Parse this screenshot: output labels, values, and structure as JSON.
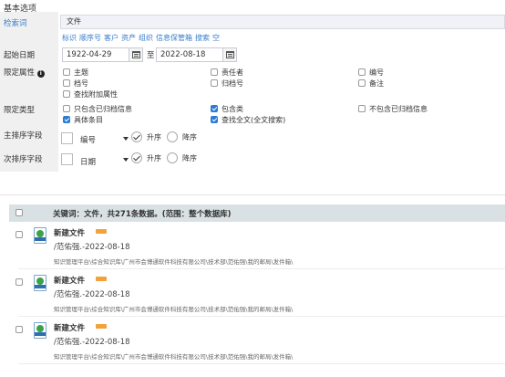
{
  "section_title": "基本选项",
  "labels": {
    "keyword": "检索词",
    "date": "起始日期",
    "attr": "限定属性",
    "type": "限定类型",
    "primary_sort": "主排序字段",
    "secondary_sort": "次排序字段"
  },
  "keyword_value": "文件",
  "keyword_links": [
    "标识",
    "顺序号",
    "客户",
    "资产",
    "组织",
    "信息保管箱",
    "搜索",
    "空"
  ],
  "date_from": "1922-04-29",
  "date_sep": "至",
  "date_to": "2022-08-18",
  "attr_options": [
    {
      "label": "主题",
      "checked": false
    },
    {
      "label": "责任者",
      "checked": false
    },
    {
      "label": "编号",
      "checked": false
    },
    {
      "label": "档号",
      "checked": false
    },
    {
      "label": "归档号",
      "checked": false
    },
    {
      "label": "备注",
      "checked": false
    },
    {
      "label": "查找附加属性",
      "checked": false
    }
  ],
  "type_options": [
    {
      "label": "只包含已归档信息",
      "checked": false
    },
    {
      "label": "包含类",
      "checked": true
    },
    {
      "label": "不包含已归档信息",
      "checked": false
    },
    {
      "label": "具体条目",
      "checked": true
    },
    {
      "label": "查找全文(全文搜索)",
      "checked": true
    }
  ],
  "primary_sort": {
    "field": "编号",
    "asc": "升序",
    "desc": "降序"
  },
  "secondary_sort": {
    "field": "日期",
    "asc": "升序",
    "desc": "降序"
  },
  "results_header": "关键词：文件，共271条数据。(范围：整个数据库)",
  "results": [
    {
      "title": "新建文件",
      "author": "/范佑强.-2022-08-18",
      "path": "知识管理平台\\综合知识库\\广州市会博通软件科技有限公司\\技术部\\范佑强\\我的邮局\\发件箱\\"
    },
    {
      "title": "新建文件",
      "author": "/范佑强.-2022-08-18",
      "path": "知识管理平台\\综合知识库\\广州市会博通软件科技有限公司\\技术部\\范佑强\\我的邮局\\发件箱\\"
    },
    {
      "title": "新建文件",
      "author": "/范佑强.-2022-08-18",
      "path": "知识管理平台\\综合知识库\\广州市会博通软件科技有限公司\\技术部\\范佑强\\我的邮局\\发件箱\\"
    }
  ],
  "colors": {
    "link": "#3a7ec8",
    "checkbox_checked": "#2b7bd6",
    "results_header_bg": "#d9e1e4",
    "new_badge": "#f2a13d"
  }
}
